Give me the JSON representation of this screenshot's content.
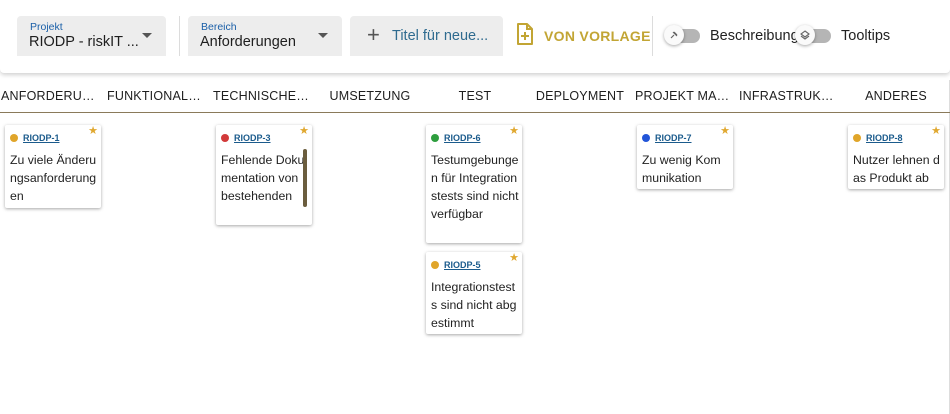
{
  "toolbar": {
    "project": {
      "label": "Projekt",
      "value": "RIODP - riskIT ..."
    },
    "area": {
      "label": "Bereich",
      "value": "Anforderungen"
    },
    "new_title_placeholder": "Titel für neue...",
    "template_button": "VON VORLAGE",
    "toggle_description": "Beschreibung",
    "toggle_tooltips": "Tooltips",
    "icons": {
      "caret": "chevron-down-icon",
      "plus": "plus-icon",
      "template": "file-plus-icon",
      "pin": "pin-icon",
      "layers": "layers-icon"
    },
    "accent_color": "#c2a534"
  },
  "columns": [
    {
      "title": "ANFORDERUNGEN"
    },
    {
      "title": "FUNKTIONALE ANFORDERUNGEN"
    },
    {
      "title": "TECHNISCHES PROBLEM"
    },
    {
      "title": "UMSETZUNG"
    },
    {
      "title": "TEST"
    },
    {
      "title": "DEPLOYMENT"
    },
    {
      "title": "PROJEKT MANAGEMENT"
    },
    {
      "title": "INFRASTRUKTUR"
    },
    {
      "title": "ANDERES"
    }
  ],
  "cards": [
    {
      "id": "RIODP-1",
      "text": "Zu viele Änderungsanforderungen",
      "status_color": "#e0a52a",
      "column": 0
    },
    {
      "id": "RIODP-3",
      "text": "Fehlende Dokumentation von bestehenden",
      "status_color": "#d23a3a",
      "column": 2
    },
    {
      "id": "RIODP-6",
      "text": "Testumgebungen für Integrationstests sind nicht verfügbar",
      "status_color": "#2e9e3e",
      "column": 4
    },
    {
      "id": "RIODP-5",
      "text": "Integrationstests sind nicht abgestimmt",
      "status_color": "#e0a52a",
      "column": 4
    },
    {
      "id": "RIODP-7",
      "text": "Zu wenig Kommunikation",
      "status_color": "#2255d8",
      "column": 6
    },
    {
      "id": "RIODP-8",
      "text": "Nutzer lehnen das Produkt ab",
      "status_color": "#e0a52a",
      "column": 8
    }
  ],
  "star_color": "#e0a830"
}
